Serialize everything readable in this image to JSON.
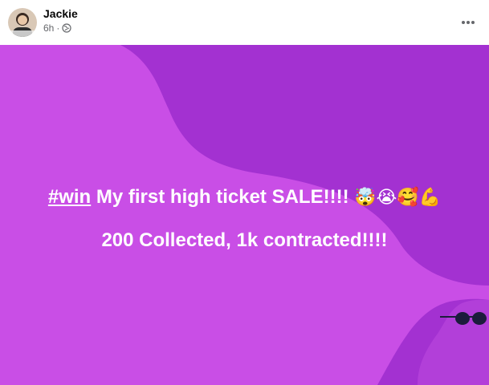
{
  "post": {
    "author": "Jackie",
    "time": "6h",
    "separator": "·",
    "audience_icon": "globe-icon",
    "more_icon": "more-options-icon"
  },
  "content": {
    "hashtag": "#win",
    "line1_text": " My first high ticket SALE!!!! ",
    "emojis": "🤯😭🥰💪",
    "line2_text": "200 Collected, 1k contracted!!!!"
  },
  "colors": {
    "background_primary": "#c94ee6",
    "background_shape": "#a331d1",
    "text": "#ffffff",
    "sunglasses": "#1c1c3c"
  }
}
